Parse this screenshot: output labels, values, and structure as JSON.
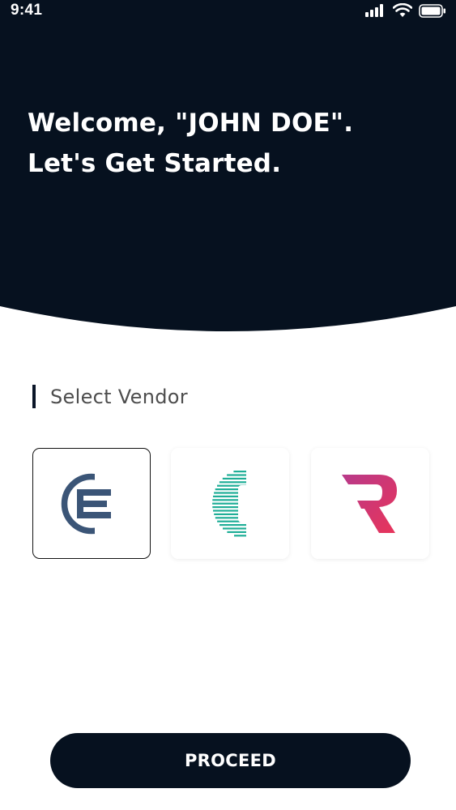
{
  "status_bar": {
    "time": "9:41",
    "icons": [
      "signal-icon",
      "wifi-icon",
      "battery-icon"
    ]
  },
  "header": {
    "welcome_line1": "Welcome, \"JOHN DOE\".",
    "welcome_line2": "Let's Get Started."
  },
  "vendor_section": {
    "title": "Select Vendor",
    "selected_index": 0,
    "vendors": [
      {
        "icon": "e-logo-icon",
        "selected": true
      },
      {
        "icon": "c-lines-logo-icon",
        "selected": false
      },
      {
        "icon": "r-logo-icon",
        "selected": false
      }
    ]
  },
  "actions": {
    "proceed_label": "PROCEED"
  },
  "colors": {
    "header_bg": "#06111f",
    "button_bg": "#06111f",
    "e_logo": "#3b5577",
    "c_logo": "#1fae97",
    "r_logo_start": "#b83a8a",
    "r_logo_end": "#e8345a",
    "section_text": "#4d4d4d"
  }
}
